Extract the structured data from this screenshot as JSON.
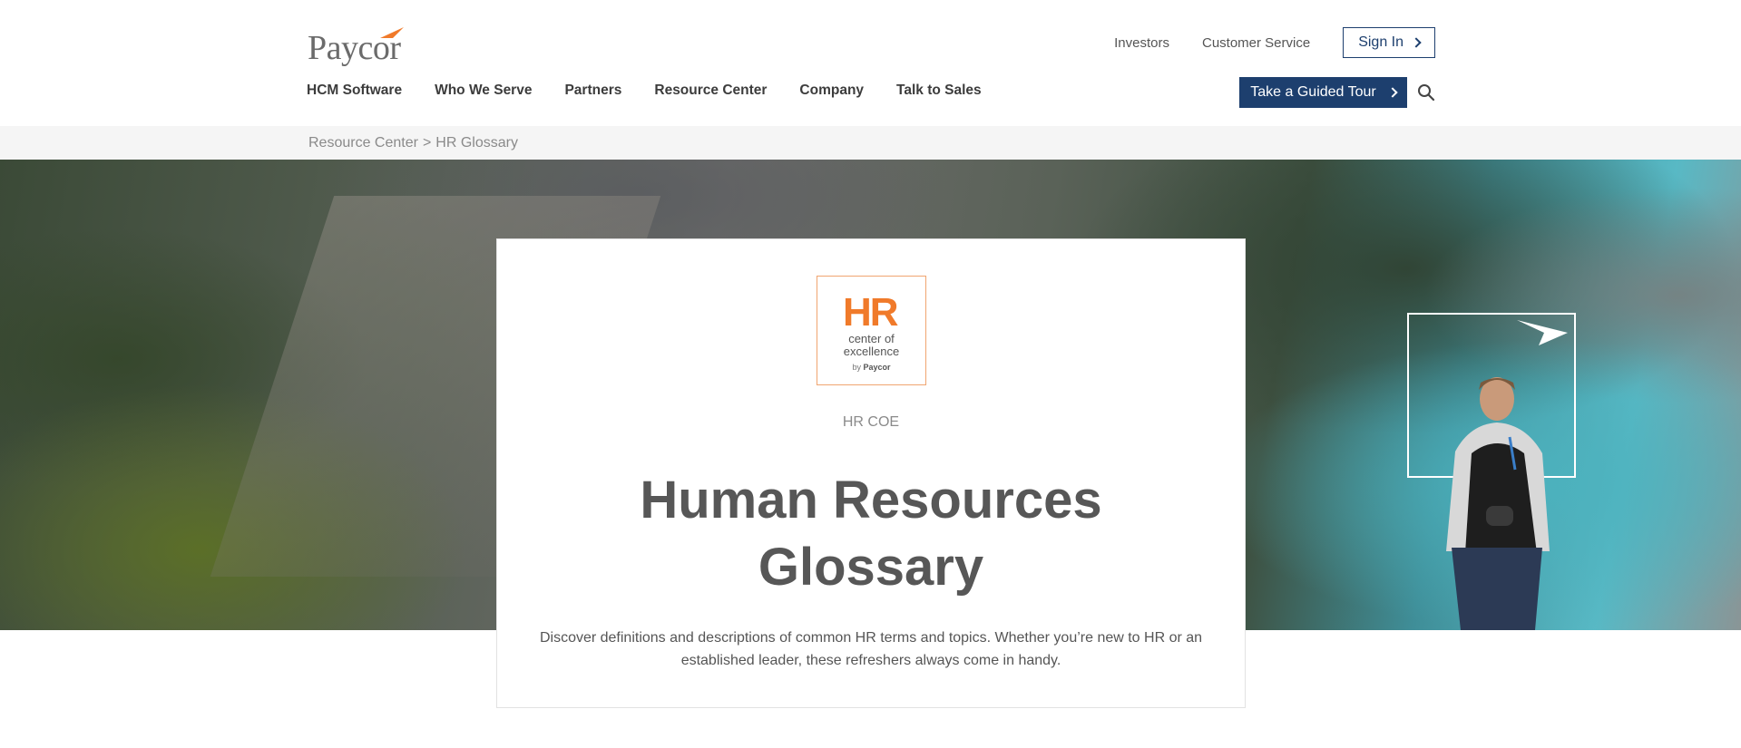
{
  "brand": {
    "logo_text": "Paycor",
    "accent": "#f07a2a",
    "navy": "#1d3f6e"
  },
  "utility_nav": {
    "investors": "Investors",
    "customer_service": "Customer Service",
    "sign_in": "Sign In"
  },
  "main_nav": {
    "items": [
      "HCM Software",
      "Who We Serve",
      "Partners",
      "Resource Center",
      "Company",
      "Talk to Sales"
    ]
  },
  "guided_tour": {
    "label": "Take a Guided Tour"
  },
  "search": {
    "icon": "search-icon"
  },
  "breadcrumb": {
    "parent": "Resource Center",
    "separator": ">",
    "current": "HR Glossary"
  },
  "hero_card": {
    "badge": {
      "hr": "HR",
      "line1": "center of",
      "line2": "excellence",
      "by": "by",
      "by_brand": "Paycor"
    },
    "eyebrow": "HR COE",
    "title_line1": "Human Resources",
    "title_line2": "Glossary",
    "description_line1": "Discover definitions and descriptions of common HR terms and topics. Whether you’re new to HR or an",
    "description_line2": "established leader, these refreshers always come in handy."
  }
}
